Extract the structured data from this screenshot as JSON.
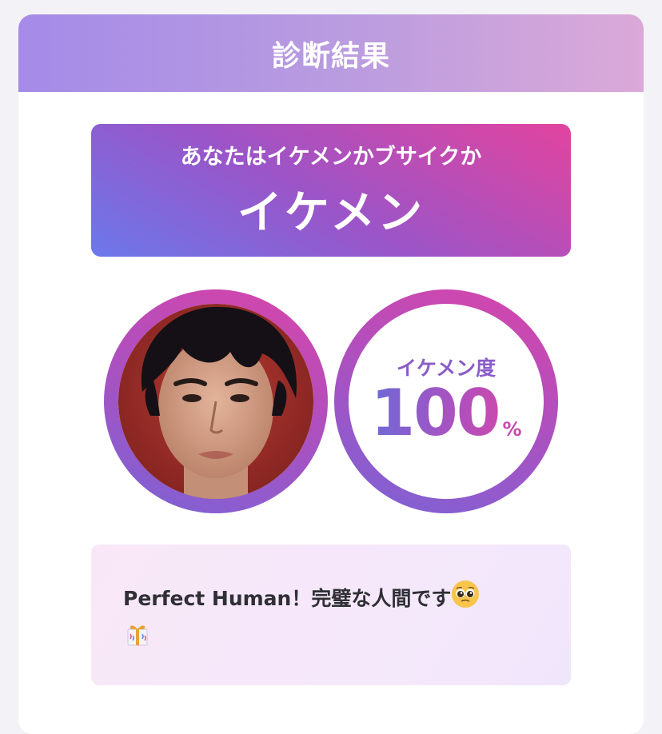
{
  "header": {
    "title": "診断結果"
  },
  "result": {
    "question": "あなたはイケメンかブサイクか",
    "answer": "イケメン"
  },
  "score": {
    "label": "イケメン度",
    "value": "100",
    "unit": "%"
  },
  "comment": {
    "text": "Perfect Human！完璧な人間です",
    "emojis": [
      "pleading-face-emoji",
      "gift-emoji"
    ]
  },
  "colors": {
    "header_gradient": [
      "#a58be8",
      "#dba9d8"
    ],
    "banner_gradient": [
      "#6b78ea",
      "#e2449e"
    ],
    "ring_gradient": [
      "#7a63d6",
      "#d845a9"
    ]
  }
}
